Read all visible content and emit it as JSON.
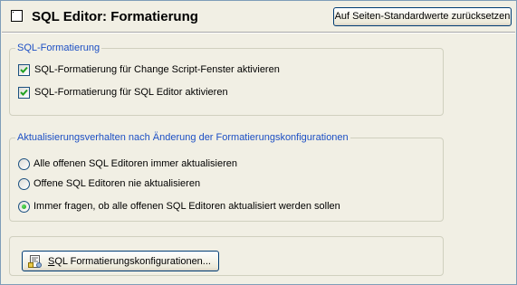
{
  "header": {
    "title": "SQL Editor: Formatierung",
    "reset_button": "Auf Seiten-Standardwerte zurücksetzen"
  },
  "group_formatting": {
    "legend": "SQL-Formatierung",
    "options": [
      {
        "label": "SQL-Formatierung für Change Script-Fenster aktivieren",
        "checked": true
      },
      {
        "label": "SQL-Formatierung für SQL Editor aktivieren",
        "checked": true
      }
    ]
  },
  "group_update": {
    "legend": "Aktualisierungsverhalten nach Änderung der Formatierungskonfigurationen",
    "options": [
      {
        "label": "Alle offenen SQL Editoren immer aktualisieren",
        "selected": false
      },
      {
        "label": "Offene SQL Editoren nie aktualisieren",
        "selected": false
      },
      {
        "label": "Immer fragen, ob alle offenen SQL Editoren aktualisiert werden sollen",
        "selected": true
      }
    ]
  },
  "config_button": {
    "label_accesskey": "S",
    "label_rest": "QL Formatierungskonfigurationen..."
  },
  "icons": {
    "header": "square-icon",
    "config_button": "formatting-config-icon"
  },
  "colors": {
    "legend_text": "#1c4fc4",
    "window_bg": "#f1efe4",
    "check_mark": "#21a121"
  }
}
